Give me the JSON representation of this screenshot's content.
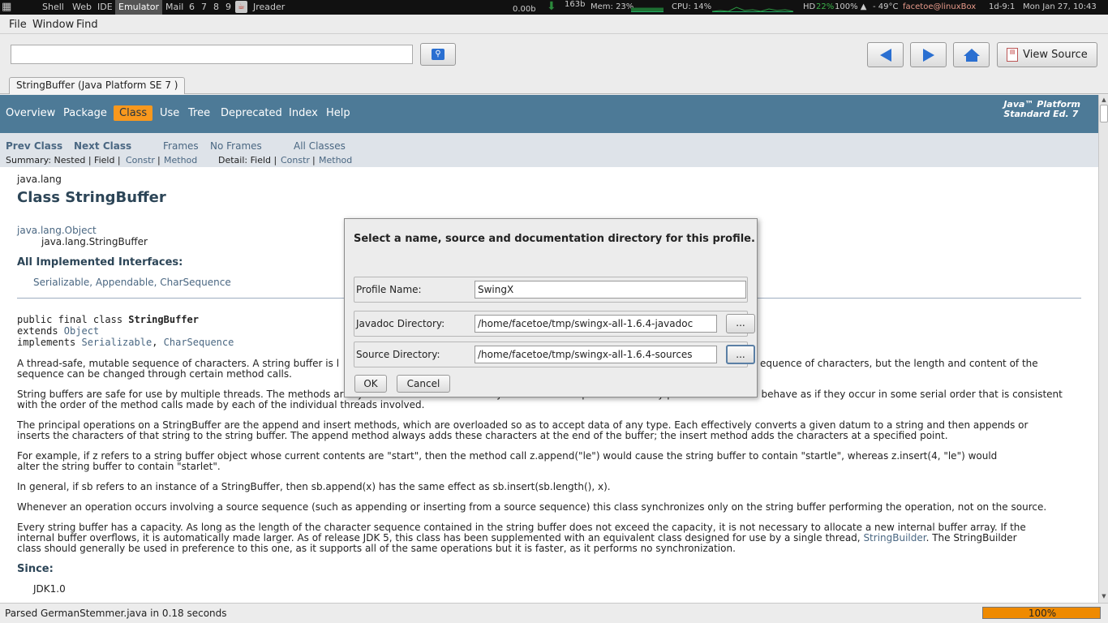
{
  "sysbar": {
    "workspaces": [
      "Shell",
      "Web",
      "IDE",
      "Emulator",
      "Mail",
      "6",
      "7",
      "8",
      "9"
    ],
    "active_workspace": "Emulator",
    "app_label": "Jreader",
    "net_rate": "0.00b",
    "net_total": "163b",
    "mem": "Mem: 23%",
    "cpu": "CPU: 14%",
    "hd_label": "HD",
    "hd_value": "22%",
    "battery": "100% ▲",
    "temp": "- 49°C",
    "user_host": "facetoe@linuxBox",
    "uptime": "1d-9:1",
    "datetime": "Mon Jan 27, 10:43"
  },
  "menubar": {
    "file": "File",
    "window": "Window",
    "find": "Find"
  },
  "toolbar": {
    "search_value": "",
    "view_source_label": "View Source"
  },
  "tab": {
    "label": "StringBuffer (Java Platform SE 7 )"
  },
  "topnav": {
    "items": [
      "Overview",
      "Package",
      "Class",
      "Use",
      "Tree",
      "Deprecated",
      "Index",
      "Help"
    ],
    "active": "Class",
    "platform_line1": "Java™ Platform",
    "platform_line2": "Standard Ed. 7"
  },
  "subnav": {
    "prev_class": "Prev Class",
    "next_class": "Next Class",
    "frames": "Frames",
    "no_frames": "No Frames",
    "all_classes": "All Classes",
    "summary_prefix": "Summary: Nested | Field |",
    "summary_constr": "Constr",
    "summary_sep": "|",
    "summary_method": "Method",
    "detail_prefix": "Detail: Field |",
    "detail_constr": "Constr",
    "detail_sep": "|",
    "detail_method": "Method"
  },
  "doc": {
    "package": "java.lang",
    "title": "Class StringBuffer",
    "inherit_parent": "java.lang.Object",
    "inherit_child": "java.lang.StringBuffer",
    "interfaces_heading": "All Implemented Interfaces:",
    "interfaces": "Serializable, Appendable, CharSequence",
    "decl_line1_a": "public final class ",
    "decl_line1_b": "StringBuffer",
    "decl_line2_a": "extends ",
    "decl_line2_b": "Object",
    "decl_line3_a": "implements ",
    "decl_line3_b": "Serializable",
    "decl_line3_c": ", ",
    "decl_line3_d": "CharSequence",
    "p1a": "A thread-safe, mutable sequence of characters. A string buffer is l",
    "p1b": "equence of characters, but the length and content of the",
    "p1c": "sequence can be changed through certain method calls.",
    "p2a": "String buffers are safe for use by multiple threads. The methods are synchronized where necessary so that all the operations on any particular instance behave as if they occur in some serial order that is consistent",
    "p2b": "with the order of the method calls made by each of the individual threads involved.",
    "p3a": "The principal operations on a StringBuffer are the append and insert methods, which are overloaded so as to accept data of any type. Each effectively converts a given datum to a string and then appends or",
    "p3b": "inserts the characters of that string to the string buffer. The append method always adds these characters at the end of the buffer; the insert method adds the characters at a specified point.",
    "p4a": "For example, if z refers to a string buffer object whose current contents are \"start\", then the method call z.append(\"le\") would cause the string buffer to contain \"startle\", whereas z.insert(4, \"le\") would",
    "p4b": "alter the string buffer to contain \"starlet\".",
    "p5": "In general, if sb refers to an instance of a StringBuffer, then sb.append(x) has the same effect as sb.insert(sb.length(), x).",
    "p6": "Whenever an operation occurs involving a source sequence (such as appending or inserting from a source sequence) this class synchronizes only on the string buffer performing the operation, not on the source.",
    "p7a": "Every string buffer has a capacity. As long as the length of the character sequence contained in the string buffer does not exceed the capacity, it is not necessary to allocate a new internal buffer array. If the",
    "p7b_a": "internal buffer overflows, it is automatically made larger. As of release JDK 5, this class has been supplemented with an equivalent class designed for use by a single thread, ",
    "p7b_link": "StringBuilder",
    "p7b_c": ". The StringBuilder",
    "p7c": "class should generally be used in preference to this one, as it supports all of the same operations but it is faster, as it performs no synchronization.",
    "since_heading": "Since:",
    "since_value": "JDK1.0"
  },
  "status": {
    "text": "Parsed GermanStemmer.java in 0.18 seconds",
    "progress_label": "100%",
    "progress": 1.0
  },
  "dialog": {
    "message": "Select a name, source and documentation directory for this profile.",
    "profile_label": "Profile Name:",
    "profile_value": "SwingX",
    "javadoc_label": "Javadoc Directory:",
    "javadoc_value": "/home/facetoe/tmp/swingx-all-1.6.4-javadoc",
    "source_label": "Source Directory:",
    "source_value": "/home/facetoe/tmp/swingx-all-1.6.4-sources",
    "browse_label": "...",
    "ok_label": "OK",
    "cancel_label": "Cancel"
  },
  "colors": {
    "nav_bg": "#4d7a97",
    "nav_active": "#f8981d",
    "subnav_bg": "#dee3e9",
    "link": "#4a6782",
    "progress": "#ef8a00"
  }
}
